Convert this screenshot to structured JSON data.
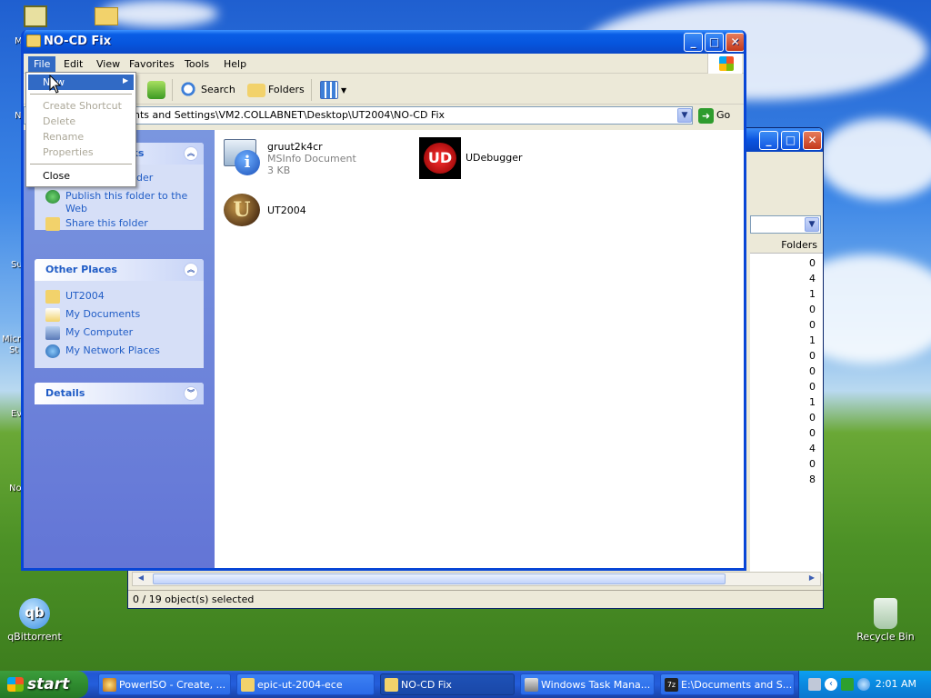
{
  "desktop": {
    "icons": [
      {
        "label": "qBittorrent"
      },
      {
        "label": "Recycle Bin"
      }
    ],
    "partial_labels": [
      "M",
      "N",
      "Su",
      "Micr",
      "St",
      "Ev",
      "No"
    ]
  },
  "back_window": {
    "column_header": "Folders",
    "counts": [
      "0",
      "4",
      "1",
      "0",
      "0",
      "1",
      "0",
      "0",
      "0",
      "1",
      "0",
      "0",
      "4",
      "0",
      "8"
    ],
    "status": "0 / 19 object(s) selected"
  },
  "main_window": {
    "title": "NO-CD Fix",
    "menu": [
      "File",
      "Edit",
      "View",
      "Favorites",
      "Tools",
      "Help"
    ],
    "toolbar": {
      "search": "Search",
      "folders": "Folders"
    },
    "address": "nts and Settings\\VM2.COLLABNET\\Desktop\\UT2004\\NO-CD Fix",
    "go": "Go",
    "tasks_panel": {
      "title_partial": "sks",
      "item_partial": "der",
      "publish": "Publish this folder to the Web",
      "share": "Share this folder"
    },
    "other_places": {
      "title": "Other Places",
      "items": [
        "UT2004",
        "My Documents",
        "My Computer",
        "My Network Places"
      ]
    },
    "details": {
      "title": "Details"
    },
    "files": [
      {
        "name": "gruut2k4cr",
        "type": "MSInfo Document",
        "size": "3 KB"
      },
      {
        "name": "UDebugger"
      },
      {
        "name": "UT2004"
      }
    ]
  },
  "file_menu": {
    "items": [
      {
        "label": "New",
        "disabled": false
      },
      {
        "label": "Create Shortcut",
        "disabled": true
      },
      {
        "label": "Delete",
        "disabled": true
      },
      {
        "label": "Rename",
        "disabled": true
      },
      {
        "label": "Properties",
        "disabled": true
      },
      {
        "label": "Close",
        "disabled": false
      }
    ]
  },
  "taskbar": {
    "start": "start",
    "tasks": [
      "PowerISO - Create, ...",
      "epic-ut-2004-ece",
      "NO-CD Fix",
      "Windows Task Mana...",
      "E:\\Documents and S..."
    ],
    "clock": "2:01 AM"
  },
  "colors": {
    "selection": "#316ac5",
    "titlebar": "#0a5ee6",
    "panel_text": "#215dc6"
  }
}
